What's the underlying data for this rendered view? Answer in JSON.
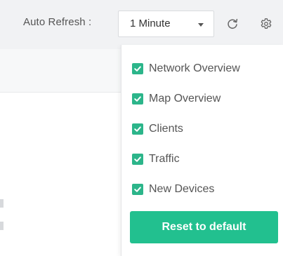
{
  "toolbar": {
    "auto_refresh_label": "Auto Refresh :",
    "interval_value": "1 Minute",
    "refresh_icon": "refresh-icon",
    "settings_icon": "gear-icon"
  },
  "widgets_menu": {
    "options": [
      {
        "label": "Network Overview",
        "checked": true
      },
      {
        "label": "Map Overview",
        "checked": true
      },
      {
        "label": "Clients",
        "checked": true
      },
      {
        "label": "Traffic",
        "checked": true
      },
      {
        "label": "New Devices",
        "checked": true
      }
    ],
    "reset_label": "Reset to default"
  },
  "colors": {
    "accent": "#22c08f",
    "checkbox": "#2cb58a"
  }
}
